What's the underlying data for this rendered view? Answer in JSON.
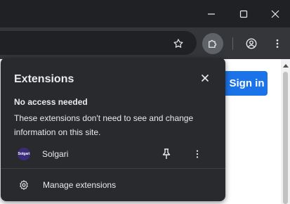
{
  "window_controls": {
    "minimize_icon": "minimize-icon",
    "maximize_icon": "maximize-icon",
    "close_icon": "close-icon"
  },
  "toolbar": {
    "bookmark_icon": "star-icon",
    "extensions_icon": "puzzle-icon",
    "profile_icon": "profile-icon",
    "menu_icon": "kebab-menu-icon"
  },
  "page": {
    "signin_label": "Sign in",
    "accent": "#1a73e8"
  },
  "extensions_popup": {
    "title": "Extensions",
    "section_heading": "No access needed",
    "section_description": "These extensions don't need to see and change information on this site.",
    "extensions": [
      {
        "name": "Solgari",
        "logo_text": "Solgari"
      }
    ],
    "manage_label": "Manage extensions"
  },
  "colors": {
    "popup_bg": "#292a2d",
    "titlebar_bg": "#202124",
    "toolbar_bg": "#35363a",
    "text": "#e8eaed"
  }
}
